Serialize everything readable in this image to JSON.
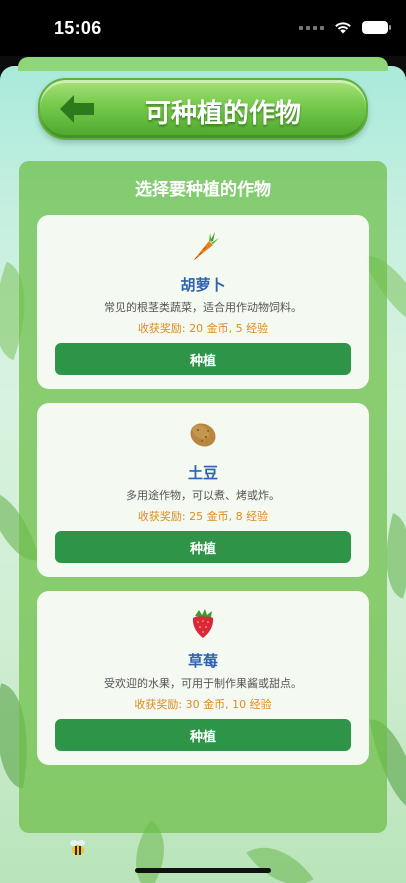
{
  "status_bar": {
    "time": "15:06"
  },
  "header": {
    "title": "可种植的作物"
  },
  "panel": {
    "title": "选择要种植的作物"
  },
  "crops": [
    {
      "icon": "carrot-icon",
      "name": "胡萝卜",
      "description": "常见的根茎类蔬菜，适合用作动物饲料。",
      "reward": "收获奖励: 20 金币, 5 经验",
      "button_label": "种植"
    },
    {
      "icon": "potato-icon",
      "name": "土豆",
      "description": "多用途作物，可以煮、烤或炸。",
      "reward": "收获奖励: 25 金币, 8 经验",
      "button_label": "种植"
    },
    {
      "icon": "strawberry-icon",
      "name": "草莓",
      "description": "受欢迎的水果，可用于制作果酱或甜点。",
      "reward": "收获奖励: 30 金币, 10 经验",
      "button_label": "种植"
    }
  ],
  "colors": {
    "accent_green": "#2e9447",
    "name_blue": "#2f63b0",
    "reward_orange": "#e08a1e"
  }
}
